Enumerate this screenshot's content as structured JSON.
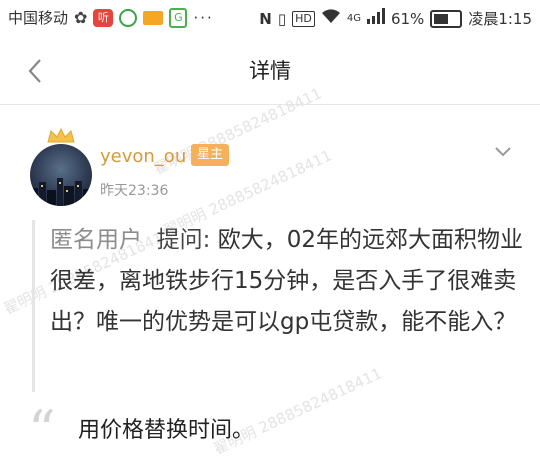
{
  "status_bar": {
    "carrier": "中国移动",
    "network": "4G",
    "battery": "61%",
    "time": "凌晨1:15"
  },
  "nav": {
    "title": "详情"
  },
  "post": {
    "username": "yevon_ou",
    "badge": "星主",
    "time": "昨天23:36"
  },
  "question": {
    "user": "匿名用户",
    "label": "提问:",
    "text": "欧大，02年的远郊大面积物业很差，离地铁步行15分钟，是否入手了很难卖出？唯一的优势是可以gp屯贷款，能不能入？"
  },
  "answer": {
    "text": "用价格替换时间。"
  },
  "watermark": "翟明明 28885824818411"
}
